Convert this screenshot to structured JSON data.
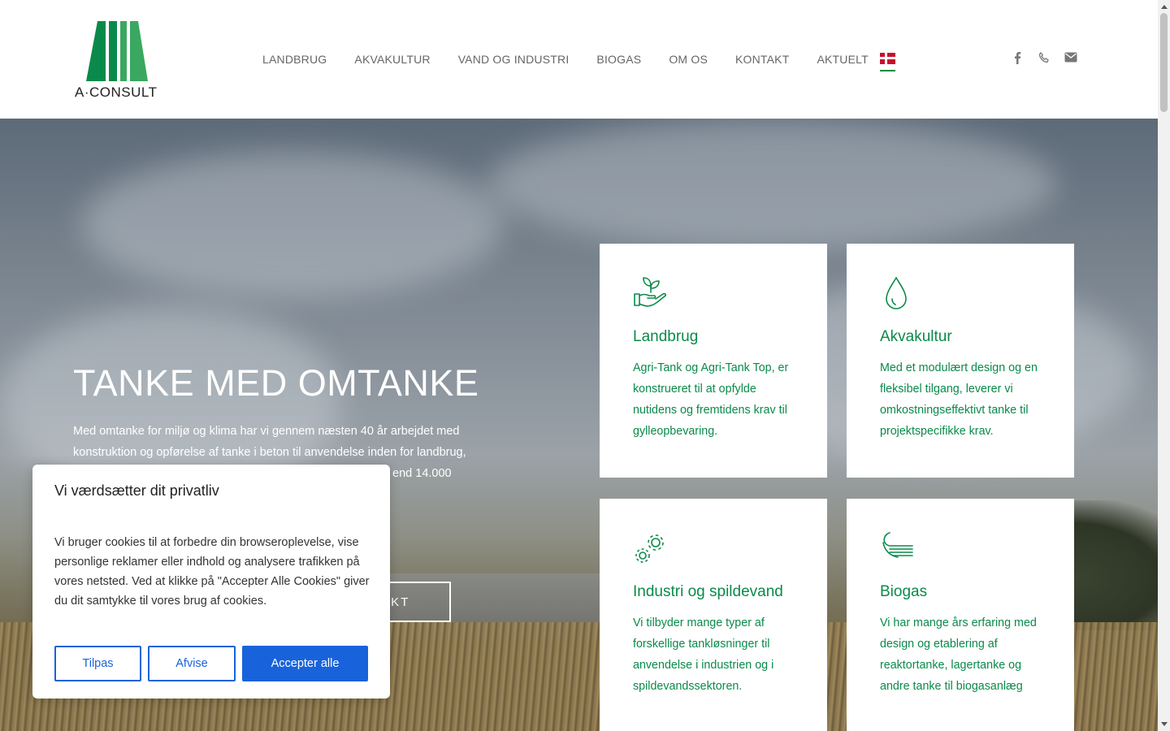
{
  "header": {
    "logo_text": "A·CONSULT",
    "nav": [
      "LANDBRUG",
      "AKVAKULTUR",
      "VAND OG INDUSTRI",
      "BIOGAS",
      "OM OS",
      "KONTAKT",
      "AKTUELT"
    ],
    "language_flag": "danish-flag-icon",
    "social_icons": [
      "facebook-icon",
      "phone-icon",
      "email-icon"
    ]
  },
  "hero": {
    "title": "TANKE MED OMTANKE",
    "text": "Med omtanke for miljø og klima har vi gennem næsten 40 år arbejdet med konstruktion og opførelse af tanke i beton til anvendelse inden for landbrug, industri, spildevand, biogas og akvakultur. Vi har opført mere end 14.000 tanke – et antal som stiger støt – i både ind- og udland.",
    "button_label": "KONTAKT"
  },
  "cards": [
    {
      "icon": "hand-plant-icon",
      "title": "Landbrug",
      "text": "Agri-Tank og Agri-Tank Top, er konstrueret til at opfylde nutidens og fremtidens krav til gylleopbevaring."
    },
    {
      "icon": "water-drop-icon",
      "title": "Akvakultur",
      "text": "Med et modulært design og en fleksibel tilgang, leverer vi omkostningseffektivt tanke til projektspecifikke krav."
    },
    {
      "icon": "gears-icon",
      "title": "Industri og spildevand",
      "text": "Vi tilbyder mange typer af forskellige tankløsninger til anvendelse i industrien og i spildevandssektoren."
    },
    {
      "icon": "wind-icon",
      "title": "Biogas",
      "text": "Vi har mange års erfaring med design og etablering af reaktortanke, lagertanke og andre tanke til biogasanlæg"
    }
  ],
  "cookie": {
    "title": "Vi værdsætter dit privatliv",
    "text": "Vi bruger cookies til at forbedre din browseroplevelse, vise personlige reklamer eller indhold og analysere trafikken på vores netsted. Ved at klikke på \"Accepter Alle Cookies\" giver du dit samtykke til vores brug af cookies.",
    "customize_label": "Tilpas",
    "reject_label": "Afvise",
    "accept_label": "Accepter alle"
  },
  "colors": {
    "brand_green": "#0a8a4a",
    "cookie_blue": "#1863dc"
  }
}
